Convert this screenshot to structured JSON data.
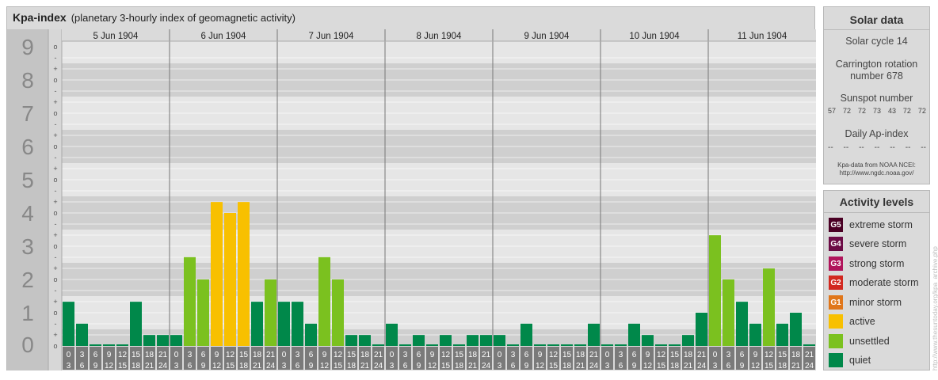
{
  "header": {
    "title": "Kpa-index",
    "subtitle": "(planetary 3-hourly index of geomagnetic activity)"
  },
  "colors": {
    "quiet": "#00884a",
    "unsettled": "#7bc11f",
    "active": "#f8c000",
    "minor_storm": "#e0761a",
    "moderate_storm": "#d2281f",
    "strong_storm": "#b0145b",
    "severe_storm": "#6b0b45",
    "extreme_storm": "#4a0024"
  },
  "chart_data": {
    "type": "bar",
    "title": "Kpa-index",
    "y_axis": {
      "range": [
        0,
        9
      ],
      "labels": [
        "0",
        "1",
        "2",
        "3",
        "4",
        "5",
        "6",
        "7",
        "8",
        "9"
      ],
      "sub_labels": [
        "o",
        "+",
        "-",
        "o"
      ]
    },
    "days": [
      "5 Jun 1904",
      "6 Jun 1904",
      "7 Jun 1904",
      "8 Jun 1904",
      "9 Jun 1904",
      "10 Jun 1904",
      "11 Jun 1904"
    ],
    "hour_start_labels": [
      "0",
      "3",
      "6",
      "9",
      "12",
      "15",
      "18",
      "21"
    ],
    "hour_end_labels": [
      "3",
      "6",
      "9",
      "12",
      "15",
      "18",
      "21",
      "24"
    ],
    "values": [
      1.33,
      0.67,
      0,
      0,
      0,
      1.33,
      0.33,
      0.33,
      0.33,
      2.67,
      2,
      4.33,
      4,
      4.33,
      1.33,
      2,
      1.33,
      1.33,
      0.67,
      2.67,
      2,
      0.33,
      0.33,
      0,
      0.67,
      0,
      0.33,
      0,
      0.33,
      0,
      0.33,
      0.33,
      0.33,
      0,
      0.67,
      0,
      0,
      0,
      0,
      0.67,
      0,
      0,
      0.67,
      0.33,
      0,
      0,
      0.33,
      1,
      3.33,
      2,
      1.33,
      0.67,
      2.33,
      0.67,
      1,
      0
    ],
    "legend": [
      "quiet",
      "unsettled",
      "active"
    ]
  },
  "solar": {
    "title": "Solar data",
    "cycle": "Solar cycle 14",
    "carrington_line1": "Carrington rotation",
    "carrington_line2": "number 678",
    "sunspot_title": "Sunspot number",
    "sunspots": [
      "57",
      "72",
      "72",
      "73",
      "43",
      "72",
      "72"
    ],
    "ap_title": "Daily Ap-index",
    "ap": [
      "--",
      "--",
      "--",
      "--",
      "--",
      "--",
      "--"
    ],
    "credit_line1": "Kpa-data from NOAA NCEI:",
    "credit_line2": "http://www.ngdc.noaa.gov/"
  },
  "activity": {
    "title": "Activity levels",
    "levels": [
      {
        "code": "G5",
        "label": "extreme storm",
        "color": "#4a0024"
      },
      {
        "code": "G4",
        "label": "severe storm",
        "color": "#6b0b45"
      },
      {
        "code": "G3",
        "label": "strong storm",
        "color": "#b0145b"
      },
      {
        "code": "G2",
        "label": "moderate storm",
        "color": "#d2281f"
      },
      {
        "code": "G1",
        "label": "minor storm",
        "color": "#e0761a"
      },
      {
        "code": "",
        "label": "active",
        "color": "#f8c000"
      },
      {
        "code": "",
        "label": "unsettled",
        "color": "#7bc11f"
      },
      {
        "code": "",
        "label": "quiet",
        "color": "#00884a"
      }
    ]
  },
  "watermark": "http://www.thesuntoday.org/kpa_archive.php"
}
